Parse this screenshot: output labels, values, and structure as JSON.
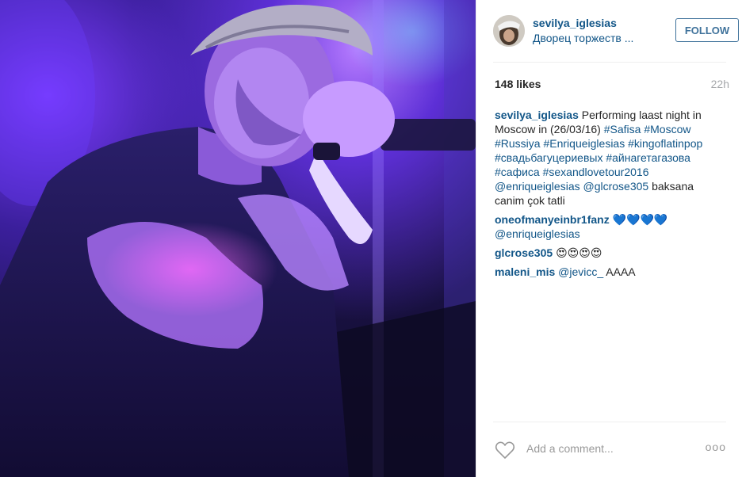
{
  "post": {
    "username": "sevilya_iglesias",
    "location": "Дворец торжеств ...",
    "follow_label": "FOLLOW",
    "likes": "148 likes",
    "time": "22h"
  },
  "caption": {
    "user": "sevilya_iglesias",
    "text_1": " Performing laast night in Moscow in (26/03/16) ",
    "tags": [
      "#Safisa",
      "#Moscow",
      "#Russiya",
      "#Enriqueiglesias",
      "#kingoflatinpop",
      "#свадьбагуцериевых",
      "#айнагетагазова",
      "#сафиса",
      "#sexandlovetour2016"
    ],
    "mention_1": "@enriqueiglesias",
    "mention_2": "@glcrose305",
    "text_2": " baksana canim çok tatli"
  },
  "comments": [
    {
      "user": "oneofmanyeinbr1fanz",
      "emoji": "💙💙💙💙",
      "mention": "@enriqueiglesias",
      "text": ""
    },
    {
      "user": "glcrose305",
      "emoji": "😍😍😍😍",
      "mention": "",
      "text": ""
    },
    {
      "user": "maleni_mis",
      "emoji": "",
      "mention": "@jevicc_",
      "text": " AAAA"
    }
  ],
  "footer": {
    "add_comment_placeholder": "Add a comment...",
    "more_label": "ooo"
  },
  "icons": {
    "like": "heart-icon",
    "more": "more-options-icon",
    "avatar": "avatar-image"
  },
  "colors": {
    "link": "#125688",
    "follow": "#3f729b",
    "muted": "#999999"
  }
}
